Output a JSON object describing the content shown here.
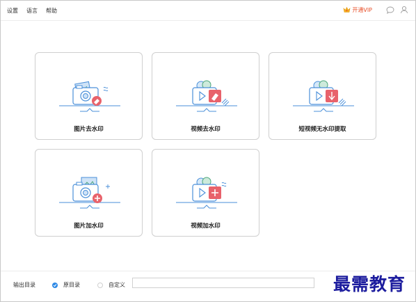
{
  "menu": {
    "settings": "设置",
    "language": "语言",
    "help": "帮助"
  },
  "top_right": {
    "vip_label": "开通VIP",
    "icons": [
      "crown-icon",
      "chat-icon",
      "user-icon"
    ]
  },
  "cards": [
    {
      "label": "图片去水印",
      "icon": "image-remove-watermark-icon"
    },
    {
      "label": "视频去水印",
      "icon": "video-remove-watermark-icon"
    },
    {
      "label": "短视频无水印提取",
      "icon": "short-video-extract-icon"
    },
    {
      "label": "图片加水印",
      "icon": "image-add-watermark-icon"
    },
    {
      "label": "视频加水印",
      "icon": "video-add-watermark-icon"
    }
  ],
  "bottom": {
    "output_dir_label": "输出目录",
    "option_original": "原目录",
    "option_custom": "自定义",
    "selected": "原目录",
    "path_value": ""
  },
  "watermark_text": "最需教育",
  "colors": {
    "accent_blue": "#2f8ae6",
    "illus_blue": "#4a8fd9",
    "illus_red": "#e8626b",
    "vip_orange": "#e8502a",
    "watermark_blue": "#1c1c9e"
  }
}
